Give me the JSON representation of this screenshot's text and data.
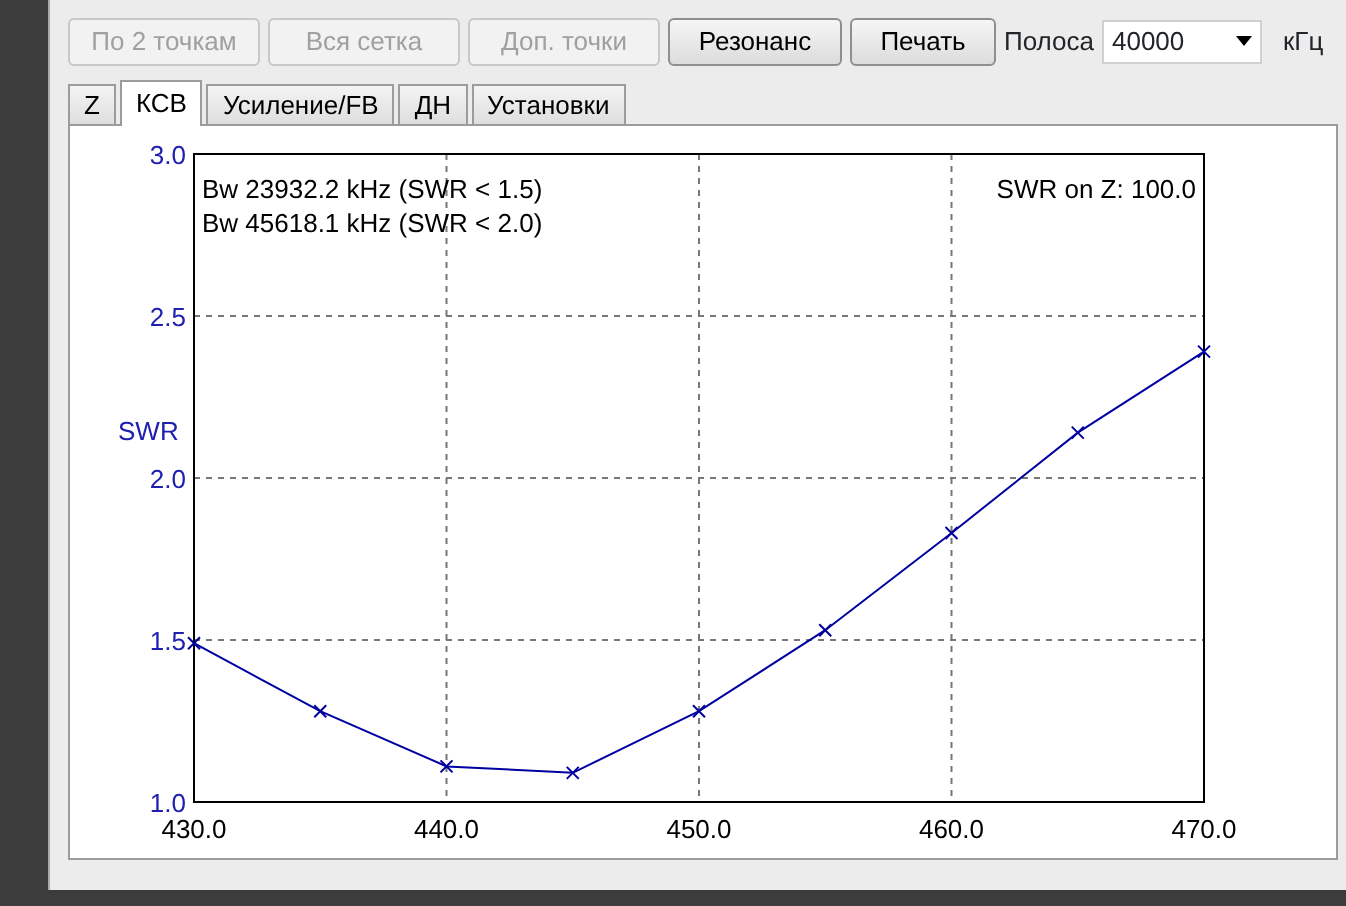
{
  "toolbar": {
    "buttons": [
      {
        "label": "По 2 точкам",
        "disabled": true
      },
      {
        "label": "Вся сетка",
        "disabled": true
      },
      {
        "label": "Доп. точки",
        "disabled": true
      },
      {
        "label": "Резонанс",
        "disabled": false
      },
      {
        "label": "Печать",
        "disabled": false
      }
    ],
    "band_label": "Полоса",
    "band_value": "40000",
    "band_unit": "кГц"
  },
  "tabs": [
    {
      "label": "Z",
      "selected": false
    },
    {
      "label": "КСВ",
      "selected": true
    },
    {
      "label": "Усиление/FB",
      "selected": false
    },
    {
      "label": "ДН",
      "selected": false
    },
    {
      "label": "Установки",
      "selected": false
    }
  ],
  "chart": {
    "bandwidth_lines": [
      "Bw 23932.2 kHz (SWR < 1.5)",
      "Bw 45618.1 kHz (SWR < 2.0)"
    ],
    "reference": "SWR on Z: 100.0",
    "chart_data": {
      "type": "line",
      "ylabel": "SWR",
      "x": [
        430,
        435,
        440,
        445,
        450,
        455,
        460,
        465,
        470
      ],
      "grid": true,
      "series": [
        {
          "color": "#0000a0",
          "marker": "x",
          "values": [
            1.49,
            1.28,
            1.11,
            1.09,
            1.28,
            1.53,
            1.83,
            2.14,
            2.39
          ]
        }
      ],
      "xlim": [
        430,
        470
      ],
      "ylim": [
        1,
        3
      ],
      "xticks": [
        {
          "value": 430,
          "label": "430.0"
        },
        {
          "value": 440,
          "label": "440.0"
        },
        {
          "value": 450,
          "label": "450.0"
        },
        {
          "value": 460,
          "label": "460.0"
        },
        {
          "value": 470,
          "label": "470.0"
        }
      ],
      "yticks": [
        {
          "value": 1,
          "label": "1.0"
        },
        {
          "value": 1.5,
          "label": "1.5"
        },
        {
          "value": 2,
          "label": "2.0"
        },
        {
          "value": 2.5,
          "label": "2.5"
        },
        {
          "value": 3,
          "label": "3.0"
        }
      ]
    }
  }
}
